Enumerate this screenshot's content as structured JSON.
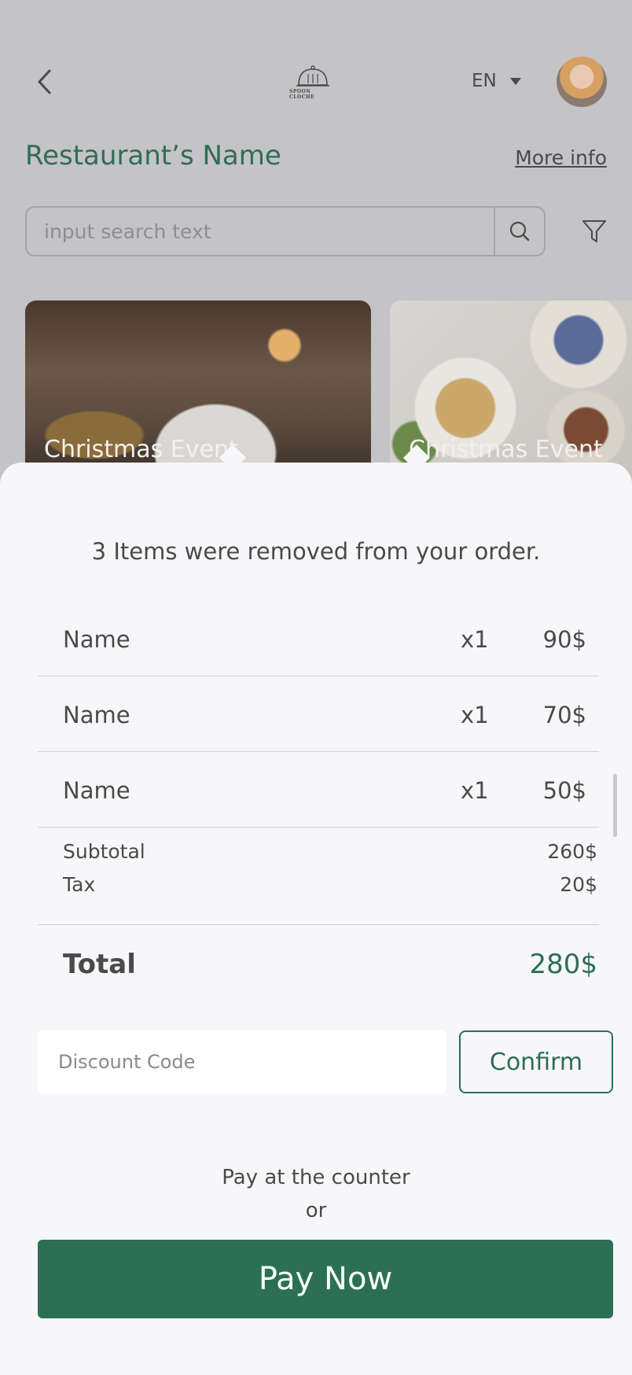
{
  "header": {
    "back_icon": "chevron-left-icon",
    "logo_text": "SPOON CLOCHE",
    "language": "EN",
    "language_dropdown_icon": "caret-down-icon"
  },
  "restaurant": {
    "name": "Restaurant’s Name",
    "more_info": "More info"
  },
  "search": {
    "placeholder": "input search text",
    "search_icon": "search-icon",
    "filter_icon": "filter-icon"
  },
  "events": [
    {
      "label": "Christmas Event"
    },
    {
      "label": "Christmas Event"
    }
  ],
  "sheet": {
    "message": "3 Items were removed from your order.",
    "items": [
      {
        "name": "Name",
        "qty": "x1",
        "price": "90$"
      },
      {
        "name": "Name",
        "qty": "x1",
        "price": "70$"
      },
      {
        "name": "Name",
        "qty": "x1",
        "price": "50$"
      }
    ],
    "subtotal_label": "Subtotal",
    "subtotal_value": "260$",
    "tax_label": "Tax",
    "tax_value": "20$",
    "total_label": "Total",
    "total_value": "280$",
    "discount_placeholder": "Discount Code",
    "confirm_label": "Confirm",
    "pay_counter_line1": "Pay at the counter",
    "pay_counter_line2": "or",
    "pay_now_label": "Pay Now"
  },
  "colors": {
    "brand_green": "#2e6e55",
    "overlay_bg": "#c4c3c6",
    "sheet_bg": "#f7f7f9"
  }
}
